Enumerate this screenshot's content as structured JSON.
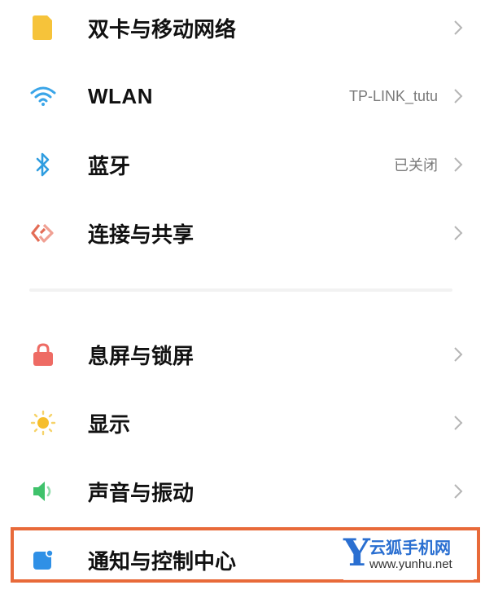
{
  "settings_groups": [
    {
      "items": [
        {
          "label": "双卡与移动网络",
          "value": "",
          "icon": "sim-card-icon",
          "icon_color": "#f6c33a"
        },
        {
          "label": "WLAN",
          "value": "TP-LINK_tutu",
          "icon": "wifi-icon",
          "icon_color": "#3aa5e8"
        },
        {
          "label": "蓝牙",
          "value": "已关闭",
          "icon": "bluetooth-icon",
          "icon_color": "#2f9de0"
        },
        {
          "label": "连接与共享",
          "value": "",
          "icon": "connection-share-icon",
          "icon_color": "#e36c55"
        }
      ]
    },
    {
      "items": [
        {
          "label": "息屏与锁屏",
          "value": "",
          "icon": "lock-icon",
          "icon_color": "#ee6b64"
        },
        {
          "label": "显示",
          "value": "",
          "icon": "sun-icon",
          "icon_color": "#f6be2a"
        },
        {
          "label": "声音与振动",
          "value": "",
          "icon": "speaker-icon",
          "icon_color": "#3fc26b"
        },
        {
          "label": "通知与控制中心",
          "value": "",
          "icon": "notification-icon",
          "icon_color": "#2f90e6"
        }
      ]
    }
  ],
  "highlight_color": "#e86a3a",
  "watermark": {
    "logo_letter": "Y",
    "name": "云狐手机网",
    "url": "www.yunhu.net",
    "color": "#2a6fd1"
  }
}
